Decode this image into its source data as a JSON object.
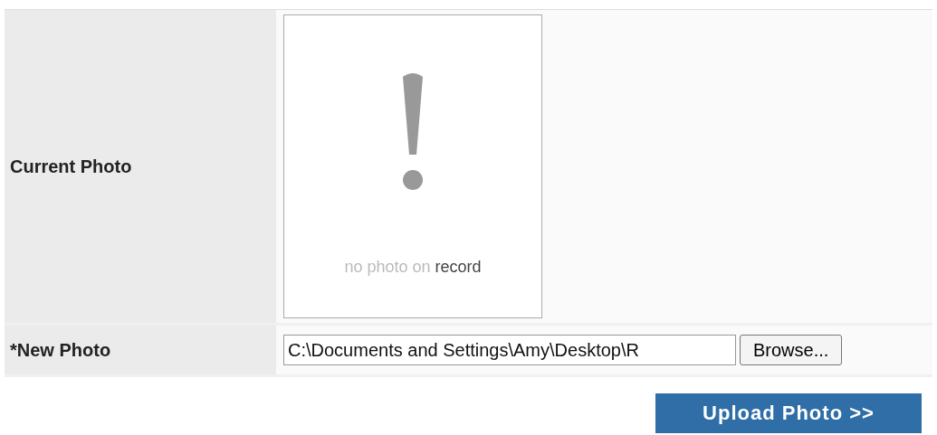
{
  "form": {
    "rows": [
      {
        "kind": "photo",
        "label": "Current Photo",
        "caption": "no photo on **record**"
      },
      {
        "kind": "file",
        "label": "*New Photo",
        "value": "C:\\Documents and Settings\\Amy\\Desktop\\R",
        "button": "Browse..."
      }
    ]
  },
  "submit": "Upload Photo >>"
}
